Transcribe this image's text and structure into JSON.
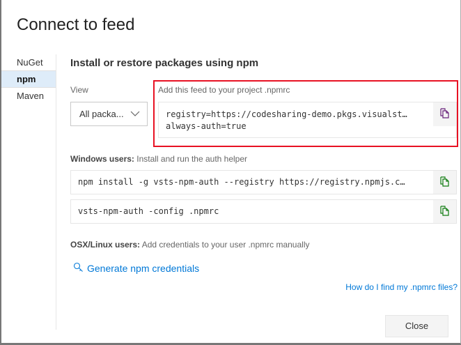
{
  "title": "Connect to feed",
  "sidebar": {
    "items": [
      {
        "label": "NuGet"
      },
      {
        "label": "npm"
      },
      {
        "label": "Maven"
      }
    ]
  },
  "main": {
    "heading": "Install or restore packages using npm",
    "view_label": "View",
    "view_value": "All packa...",
    "npmrc_label": "Add this feed to your project .npmrc",
    "npmrc_line1": "registry=https://codesharing-demo.pkgs.visualst…",
    "npmrc_line2": "always-auth=true",
    "windows_bold": "Windows users:",
    "windows_text": " Install and run the auth helper",
    "cmd1": "npm install -g vsts-npm-auth --registry https://registry.npmjs.c…",
    "cmd2": "vsts-npm-auth -config .npmrc",
    "osx_bold": "OSX/Linux users:",
    "osx_text": " Add credentials to your user .npmrc manually",
    "generate_link": "Generate npm credentials",
    "help_link": "How do I find my .npmrc files?",
    "close_label": "Close"
  },
  "colors": {
    "accent": "#0078d7",
    "highlight": "#e81123",
    "selected": "#deecf9"
  }
}
